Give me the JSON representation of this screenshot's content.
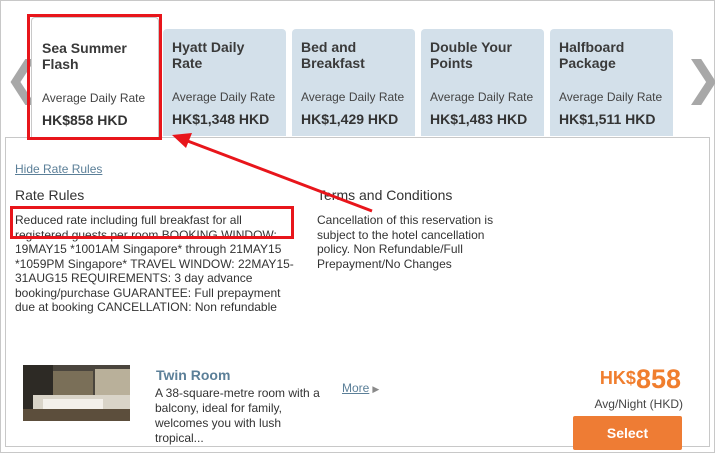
{
  "nav": {
    "prev_glyph": "❮",
    "next_glyph": "❯"
  },
  "tabs": [
    {
      "name": "Sea Summer Flash",
      "sub": "Average Daily Rate",
      "price": "HK$858 HKD"
    },
    {
      "name": "Hyatt Daily Rate",
      "sub": "Average Daily Rate",
      "price": "HK$1,348 HKD"
    },
    {
      "name": "Bed and Breakfast",
      "sub": "Average Daily Rate",
      "price": "HK$1,429 HKD"
    },
    {
      "name": "Double Your Points",
      "sub": "Average Daily Rate",
      "price": "HK$1,483 HKD"
    },
    {
      "name": "Halfboard Package",
      "sub": "Average Daily Rate",
      "price": "HK$1,511 HKD"
    }
  ],
  "rates": {
    "hide_link": "Hide Rate Rules",
    "rules_heading": "Rate Rules",
    "rules_text": "Reduced rate including full breakfast for all registered guests per room BOOKING WINDOW: 19MAY15 *1001AM Singapore* through 21MAY15 *1059PM Singapore* TRAVEL WINDOW: 22MAY15-31AUG15 REQUIREMENTS: 3 day advance booking/purchase GUARANTEE: Full prepayment due at booking CANCELLATION: Non refundable",
    "terms_heading": "Terms and Conditions",
    "terms_text": "Cancellation of this reservation is subject to the hotel cancellation policy. Non Refundable/Full Prepayment/No Changes"
  },
  "room": {
    "title": "Twin Room",
    "description": "A 38-square-metre room with a balcony, ideal for family, welcomes you with lush tropical...",
    "more_label": "More",
    "price_currency": "HK$",
    "price_value": "858",
    "price_note": "Avg/Night (HKD)",
    "select_label": "Select"
  },
  "colors": {
    "accent": "#ee7c34",
    "link": "#5b7f98",
    "tab_bg": "#d3e0ea",
    "highlight": "#e8151b"
  }
}
